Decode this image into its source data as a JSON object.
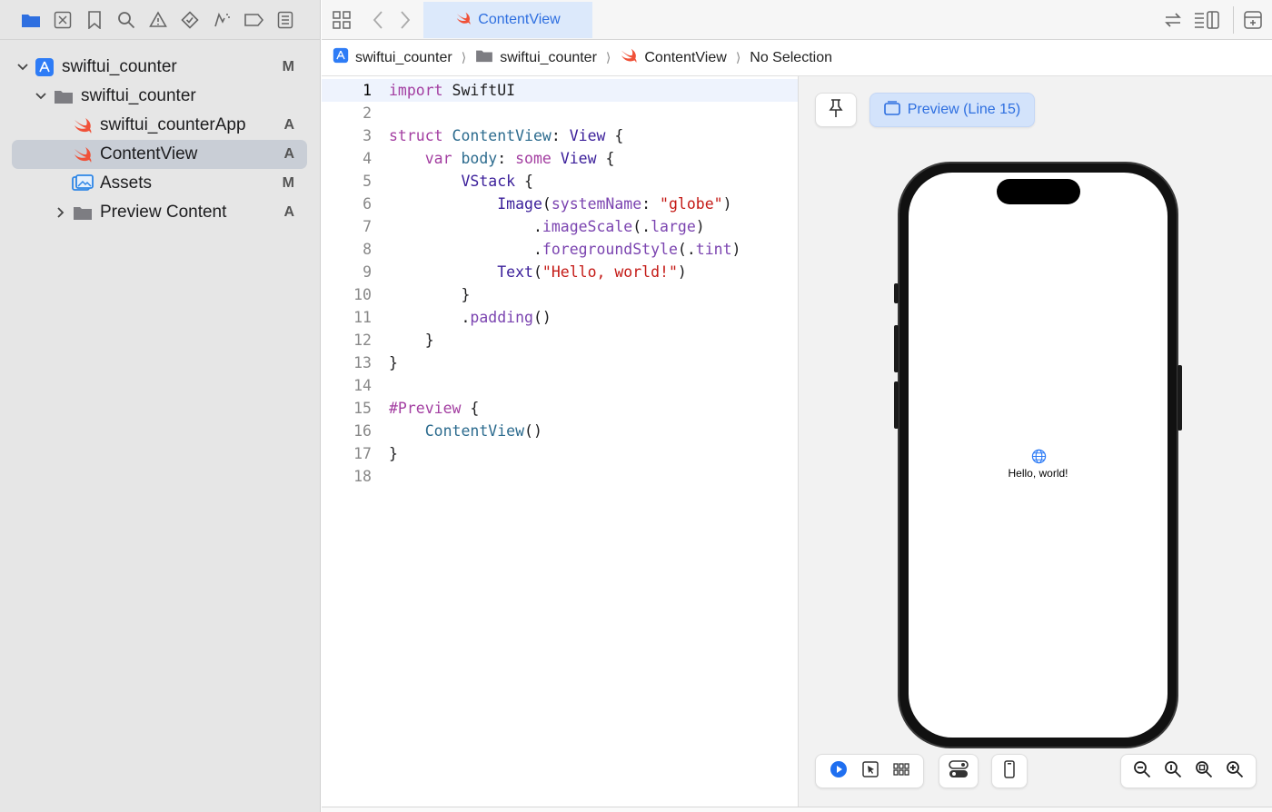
{
  "navigator": {
    "icons": [
      "folder-icon",
      "source-control-icon",
      "bookmark-icon",
      "find-icon",
      "issue-icon",
      "test-icon",
      "debug-icon",
      "breakpoint-icon",
      "report-icon"
    ],
    "tree": [
      {
        "label": "swiftui_counter",
        "badge": "M",
        "type": "project",
        "expanded": true
      },
      {
        "label": "swiftui_counter",
        "badge": "",
        "type": "folder",
        "expanded": true
      },
      {
        "label": "swiftui_counterApp",
        "badge": "A",
        "type": "swift"
      },
      {
        "label": "ContentView",
        "badge": "A",
        "type": "swift",
        "selected": true
      },
      {
        "label": "Assets",
        "badge": "M",
        "type": "assets"
      },
      {
        "label": "Preview Content",
        "badge": "A",
        "type": "folder",
        "expanded": false
      }
    ]
  },
  "tab": {
    "label": "ContentView"
  },
  "jumpbar": {
    "items": [
      "swiftui_counter",
      "swiftui_counter",
      "ContentView",
      "No Selection"
    ]
  },
  "editor": {
    "line_numbers": [
      "1",
      "2",
      "3",
      "4",
      "5",
      "6",
      "7",
      "8",
      "9",
      "10",
      "11",
      "12",
      "13",
      "14",
      "15",
      "16",
      "17",
      "18"
    ],
    "lines": [
      "import SwiftUI",
      "",
      "struct ContentView: View {",
      "    var body: some View {",
      "        VStack {",
      "            Image(systemName: \"globe\")",
      "                .imageScale(.large)",
      "                .foregroundStyle(.tint)",
      "            Text(\"Hello, world!\")",
      "        }",
      "        .padding()",
      "    }",
      "}",
      "",
      "#Preview {",
      "    ContentView()",
      "}",
      ""
    ]
  },
  "canvas": {
    "preview_label": "Preview (Line 15)",
    "hello_text": "Hello, world!"
  },
  "colors": {
    "accent": "#2e6fe0",
    "swift": "#f05138",
    "sidebar_bg": "#e6e6e6"
  }
}
